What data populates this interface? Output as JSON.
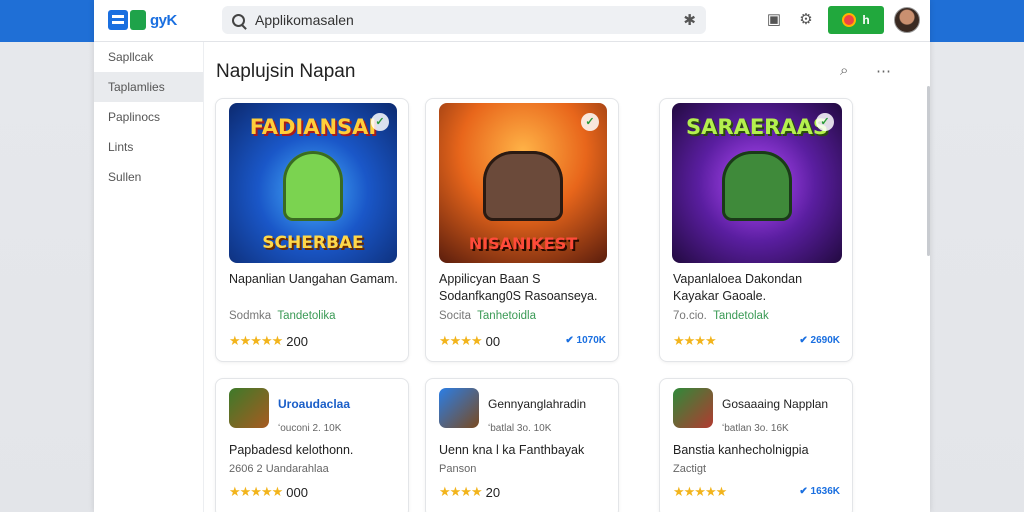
{
  "header": {
    "logo_text": "gyK",
    "search_text": "Applikomasalen",
    "button_label": "h"
  },
  "sidebar": {
    "items": [
      {
        "label": "Sapllcak"
      },
      {
        "label": "Taplamlies"
      },
      {
        "label": "Paplinocs"
      },
      {
        "label": "Lints"
      },
      {
        "label": "Sullen"
      }
    ]
  },
  "main": {
    "title": "Naplujsin Napan",
    "cards_row1": [
      {
        "image_top": "FADIANSAI",
        "image_bottom": "SCHERBAE",
        "title": "Napanlian Uangahan Gamam.",
        "sub_plain": "Sodmka",
        "sub_accent": "Tandetolika",
        "stars": "★★★★★",
        "rating": "200",
        "downloads": ""
      },
      {
        "image_top": "",
        "image_bottom": "NISANIKEST",
        "title": "Appilicyan Baan S Sodanfkang0S Rasoanseya.",
        "sub_plain": "Socita",
        "sub_accent": "Tanhetoidla",
        "stars": "★★★★",
        "rating": "00",
        "downloads": "✔ 1070K"
      },
      {
        "image_top": "SARAERAAS",
        "image_bottom": "",
        "title": "Vapanlaloea Dakondan Kayakar Gaoale.",
        "sub_plain": "7o.cio.",
        "sub_accent": "Tandetolak",
        "stars": "★★★★",
        "rating": "",
        "downloads": "✔ 2690K"
      }
    ],
    "cards_row2": [
      {
        "name": "Uroaudaclaa",
        "meta": "ʻouconi 2. 10K",
        "title": "Papbadesd kelothonn.",
        "sub": "2606 2 Uandarahlaa",
        "stars": "★★★★★",
        "rating": "000",
        "downloads": ""
      },
      {
        "name": "Gennyanglahradin",
        "meta": "ʻbatlal 3o. 10K",
        "title": "Uenn kna l ka Fanthbayak",
        "sub": "Panson",
        "stars": "★★★★",
        "rating": "20",
        "downloads": ""
      },
      {
        "name": "Gosaaaing Napplan",
        "meta": "ʻbatlan 3o. 16K",
        "title": "Banstia kanhecholnigpia",
        "sub": "Zactigt",
        "stars": "★★★★★",
        "rating": "",
        "downloads": "✔ 1636K"
      }
    ]
  },
  "colors": {
    "accent": "#1f6fd6",
    "button_green": "#21a83d",
    "star": "#f2b41c"
  },
  "icons": [
    "search-icon",
    "star-icon",
    "window-icon",
    "gear-icon",
    "avatar",
    "filter-search-icon",
    "more-icon",
    "verified-icon"
  ]
}
